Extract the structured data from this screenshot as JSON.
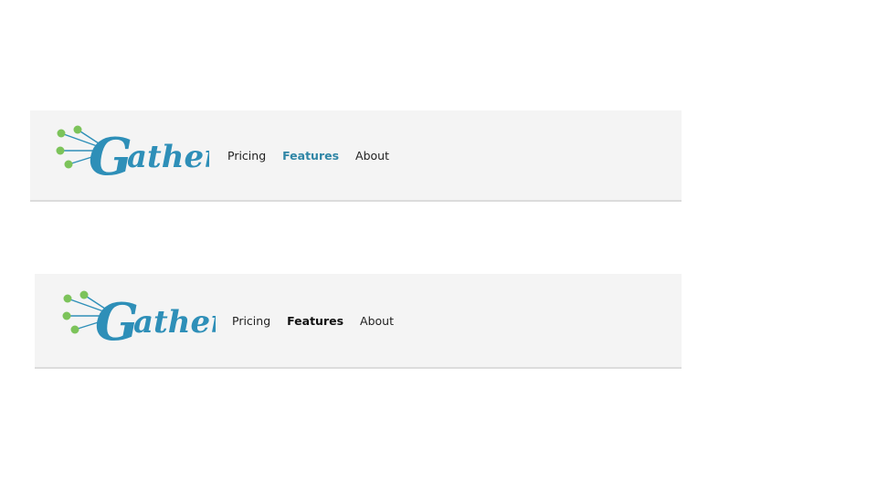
{
  "navbars": [
    {
      "logo_text": "Gather",
      "links": [
        "Pricing",
        "Features",
        "About"
      ],
      "active_link": "Features",
      "active_color": "#2f86a6"
    },
    {
      "logo_text": "Gather",
      "links": [
        "Pricing",
        "Features",
        "About"
      ],
      "active_link": "Features",
      "active_color": "#111111"
    }
  ],
  "colors": {
    "navbar_bg": "#f4f4f4",
    "navbar_border": "#dcdcdc",
    "logo_blue": "#2e8fb8",
    "logo_dots": "#7cc35a"
  }
}
